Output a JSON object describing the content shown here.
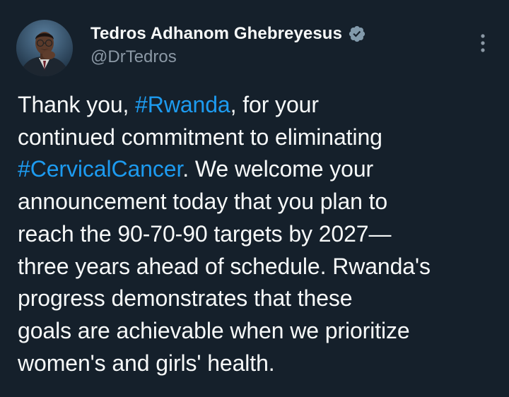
{
  "author": {
    "display_name": "Tedros Adhanom Ghebreyesus",
    "handle": "@DrTedros",
    "verified_icon": "verified-badge-icon"
  },
  "menu": {
    "icon": "more-options-icon"
  },
  "tweet": {
    "lines": [
      {
        "pre": "Thank you, ",
        "tag": "#Rwanda",
        "post": ", for your"
      },
      {
        "pre": "continued commitment to eliminating",
        "tag": "",
        "post": ""
      },
      {
        "pre": "",
        "tag": "#CervicalCancer",
        "post": ". We welcome your"
      },
      {
        "pre": "announcement today that you plan to",
        "tag": "",
        "post": ""
      },
      {
        "pre": "reach the 90-70-90 targets by 2027—",
        "tag": "",
        "post": ""
      },
      {
        "pre": "three years ahead of schedule. Rwanda's",
        "tag": "",
        "post": ""
      },
      {
        "pre": "progress demonstrates that these",
        "tag": "",
        "post": ""
      },
      {
        "pre": "goals are achievable when we prioritize",
        "tag": "",
        "post": ""
      },
      {
        "pre": "women's and girls' health.",
        "tag": "",
        "post": ""
      }
    ]
  },
  "colors": {
    "background": "#15202B",
    "text": "#F7F9F9",
    "secondary": "#8B98A5",
    "link": "#1D9BF0",
    "verified": "#829AAB"
  }
}
